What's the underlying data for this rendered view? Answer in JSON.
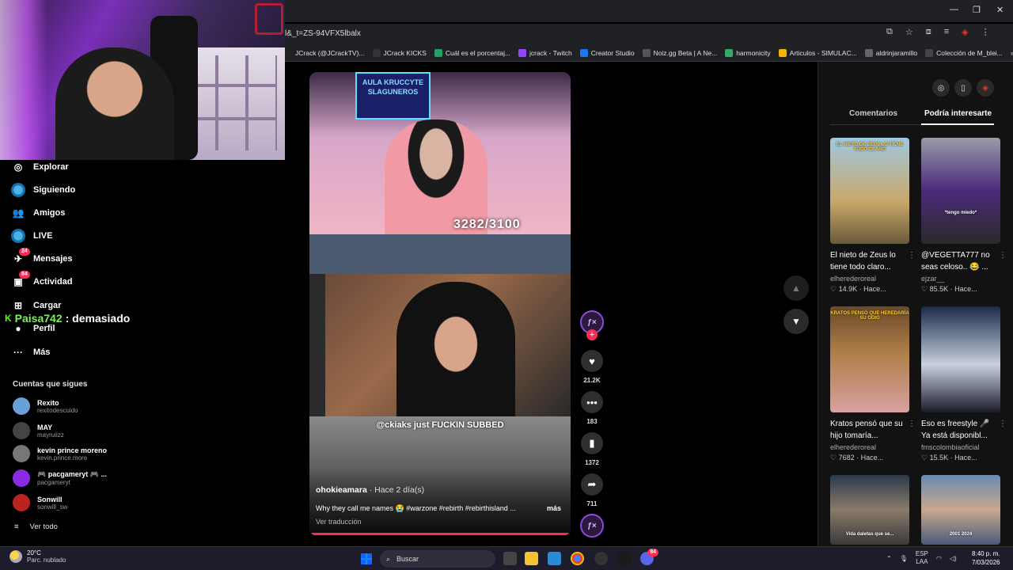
{
  "browser": {
    "url": "l&_t=ZS-94VFX5lbalx",
    "bookmarks": [
      {
        "label": "JCrack (@JCrackTV)...",
        "color": "#222"
      },
      {
        "label": "JCrack KICKS",
        "color": "#333"
      },
      {
        "label": "Cuál es el porcentaj...",
        "color": "#1fa463"
      },
      {
        "label": "jcrack - Twitch",
        "color": "#9146ff"
      },
      {
        "label": "Creator Studio",
        "color": "#1877f2"
      },
      {
        "label": "Noiz.gg Beta | A Ne...",
        "color": "#555"
      },
      {
        "label": "harmonicity",
        "color": "#3a6"
      },
      {
        "label": "Articulos - SIMULAC...",
        "color": "#f4b400"
      },
      {
        "label": "aldrinjaramillo",
        "color": "#666"
      },
      {
        "label": "Colección de M_blei...",
        "color": "#444"
      }
    ],
    "more_bookmarks": "»",
    "window_controls": {
      "minimize": "—",
      "restore": "❐",
      "close": "✕"
    }
  },
  "sidebar": {
    "items": [
      {
        "label": "Explorar",
        "icon": "compass-icon",
        "glyph": "◎"
      },
      {
        "label": "Siguiendo",
        "icon": "following-avatar-icon",
        "glyph": ""
      },
      {
        "label": "Amigos",
        "icon": "friends-icon",
        "glyph": "👥"
      },
      {
        "label": "LIVE",
        "icon": "live-icon",
        "glyph": ""
      },
      {
        "label": "Mensajes",
        "icon": "messages-icon",
        "glyph": "✈",
        "badge": "24"
      },
      {
        "label": "Actividad",
        "icon": "activity-icon",
        "glyph": "▣",
        "badge": "84"
      },
      {
        "label": "Cargar",
        "icon": "upload-icon",
        "glyph": "⊞"
      },
      {
        "label": "Perfil",
        "icon": "profile-icon",
        "glyph": "●"
      },
      {
        "label": "Más",
        "icon": "more-icon",
        "glyph": "···"
      }
    ],
    "follow_title": "Cuentas que sigues",
    "accounts": [
      {
        "name": "Rexito",
        "user": "rexitodescuido",
        "color": "#6aa0d8"
      },
      {
        "name": "MAY",
        "user": "mayruiizz",
        "color": "#444"
      },
      {
        "name": "kevin prince moreno",
        "user": "kevin.prince.more",
        "color": "#777"
      },
      {
        "name": "🎮 pacgameryt 🎮 ...",
        "user": "pacgameryt",
        "color": "#8a2be2"
      },
      {
        "name": "Sonwill",
        "user": "sonwill_sw",
        "color": "#b22"
      }
    ],
    "see_all": "Ver todo"
  },
  "chat": {
    "badge": "K",
    "user": "Paisa742",
    "message": ": demasiado"
  },
  "video": {
    "neon_text": "AULA KRUCCYTE SLAGUNEROS",
    "score": "3282/3100",
    "overlay_text": "@ckiaks just FUCKIN SUBBED",
    "author": "ohokieamara",
    "time": " · Hace 2 día(s)",
    "description": "Why they call me names 😭 #warzone #rebirth #rebirthisland ...",
    "more": "más",
    "translate": "Ver traducción",
    "progress": 1.0
  },
  "actions": {
    "likes": "21.2K",
    "comments": "183",
    "saves": "1372",
    "shares": "711"
  },
  "right_panel": {
    "tabs": [
      "Comentarios",
      "Podría interesarte"
    ],
    "cards": [
      {
        "title": "El nieto de Zeus lo tiene todo claro...",
        "author": "elherederoreal",
        "likes": "14.9K",
        "time": "Hace...",
        "caption": "EL NIETO DE ZEUS LO TIENE TODO CLARO",
        "bg": "linear-gradient(180deg,#a0c8e0,#c9a86a 60%, #6a5a3a)"
      },
      {
        "title": "@VEGETTA777 no seas celoso.. 😂 ...",
        "author": "ejzar__",
        "likes": "85.5K",
        "time": "Hace...",
        "caption": "*tengo miedo*",
        "bg": "linear-gradient(180deg,#9a9aa8,#4a2a7a 50%, #2a2a2a)"
      },
      {
        "title": "Kratos pensó que su hijo tomaría...",
        "author": "elherederoreal",
        "likes": "7682",
        "time": "Hace...",
        "caption": "KRATOS PENSÓ QUE HEREDARÍA SU ODIO",
        "bg": "linear-gradient(180deg,#6a4a2a,#b0804a 45%, #d8a0a0)"
      },
      {
        "title": "Eso es freestyle 🎤 Ya está disponibl...",
        "author": "fmscolombiaoficial",
        "likes": "15.5K",
        "time": "Hace...",
        "caption": "",
        "bg": "linear-gradient(180deg,#1a2a4a,#c8d0e0 55%, #1a1a2a)"
      },
      {
        "title": "",
        "author": "",
        "likes": "",
        "time": "",
        "caption": "Vida daletas que se...",
        "bg": "linear-gradient(180deg,#2a3a4a,#8a7a6a 50%, #3a3a3a)"
      },
      {
        "title": "",
        "author": "",
        "likes": "",
        "time": "",
        "caption": "2001    2024",
        "bg": "linear-gradient(180deg,#6a8ab0,#c8a890 50%, #4a5a7a)"
      }
    ]
  },
  "taskbar": {
    "temp": "20°C",
    "condition": "Parc. nublado",
    "search_placeholder": "Buscar",
    "lang": "ESP",
    "lang2": "LAA",
    "time": "8:40 p. m.",
    "date": "7/03/2026",
    "discord_badge": "84"
  }
}
